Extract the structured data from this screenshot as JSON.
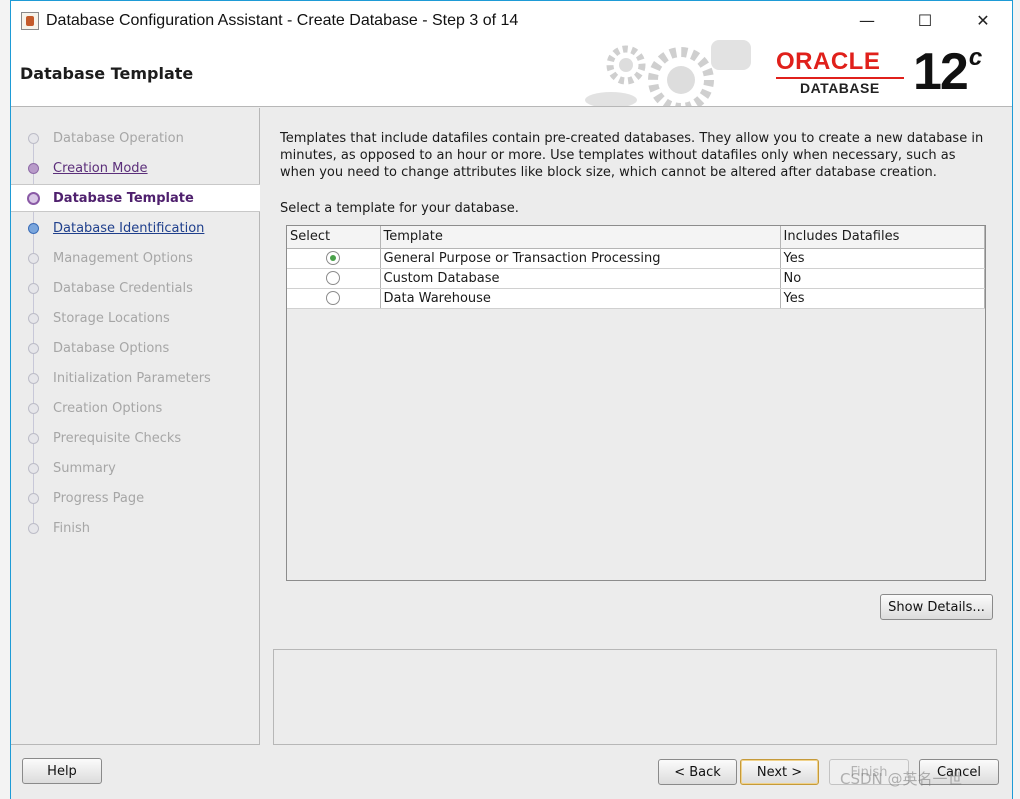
{
  "window": {
    "title": "Database Configuration Assistant - Create Database - Step 3 of 14",
    "minimize": "—",
    "maximize": "☐",
    "close": "✕"
  },
  "header": {
    "title": "Database Template",
    "brand": "ORACLE",
    "brand_sub": "DATABASE",
    "version": "12",
    "version_sup": "c"
  },
  "nav": {
    "items": [
      {
        "label": "Database Operation",
        "state": "disabled"
      },
      {
        "label": "Creation Mode",
        "state": "done"
      },
      {
        "label": "Database Template",
        "state": "current"
      },
      {
        "label": "Database Identification",
        "state": "link"
      },
      {
        "label": "Management Options",
        "state": "disabled"
      },
      {
        "label": "Database Credentials",
        "state": "disabled"
      },
      {
        "label": "Storage Locations",
        "state": "disabled"
      },
      {
        "label": "Database Options",
        "state": "disabled"
      },
      {
        "label": "Initialization Parameters",
        "state": "disabled"
      },
      {
        "label": "Creation Options",
        "state": "disabled"
      },
      {
        "label": "Prerequisite Checks",
        "state": "disabled"
      },
      {
        "label": "Summary",
        "state": "disabled"
      },
      {
        "label": "Progress Page",
        "state": "disabled"
      },
      {
        "label": "Finish",
        "state": "disabled"
      }
    ]
  },
  "content": {
    "description": "Templates that include datafiles contain pre-created databases. They allow you to create a new database in minutes, as opposed to an hour or more. Use templates without datafiles only when necessary, such as when you need to change attributes like block size, which cannot be altered after database creation.",
    "prompt": "Select a template for your database.",
    "table": {
      "headers": [
        "Select",
        "Template",
        "Includes Datafiles"
      ],
      "rows": [
        {
          "selected": true,
          "template": "General Purpose or Transaction Processing",
          "datafiles": "Yes"
        },
        {
          "selected": false,
          "template": "Custom Database",
          "datafiles": "No"
        },
        {
          "selected": false,
          "template": "Data Warehouse",
          "datafiles": "Yes"
        }
      ]
    },
    "show_details": "Show Details..."
  },
  "footer": {
    "help": "Help",
    "back": "< Back",
    "next": "Next >",
    "finish": "Finish",
    "cancel": "Cancel"
  },
  "watermark": "CSDN @英名一世"
}
